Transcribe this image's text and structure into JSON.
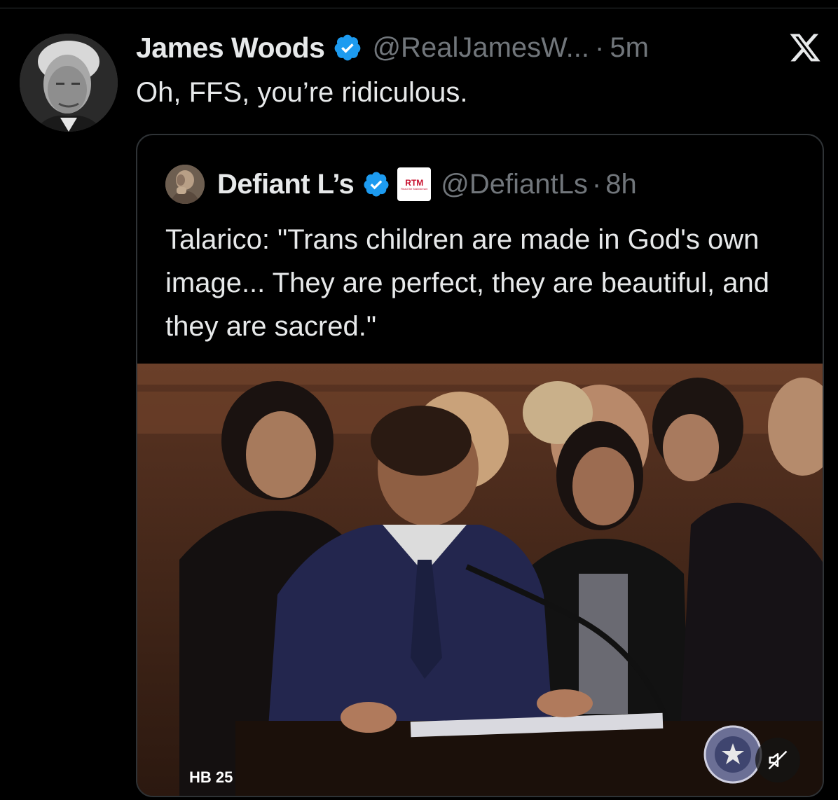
{
  "tweet": {
    "author_name": "James Woods",
    "handle": "@RealJamesW...",
    "separator": "·",
    "time": "5m",
    "text": "Oh, FFS, you’re ridiculous."
  },
  "quoted_tweet": {
    "author_name": "Defiant L’s",
    "affiliate_badge_text": "RTM",
    "affiliate_badge_subtext": "Read the Mainstream",
    "handle": "@DefiantLs",
    "separator": "·",
    "time": "8h",
    "text": "Talarico: \"Trans children are made in God's own image... They are perfect, they are beautiful, and they are sacred.\"",
    "video": {
      "caption": "HB 25",
      "muted": true
    }
  },
  "colors": {
    "background": "#000000",
    "text_primary": "#e7e9ea",
    "text_secondary": "#71767b",
    "border": "#2f3336",
    "verified_blue": "#1d9bf0",
    "rtm_red": "#c8102e"
  },
  "icons": {
    "verified": "verified-badge-icon",
    "close": "x-logo-icon",
    "mute": "speaker-muted-icon"
  }
}
